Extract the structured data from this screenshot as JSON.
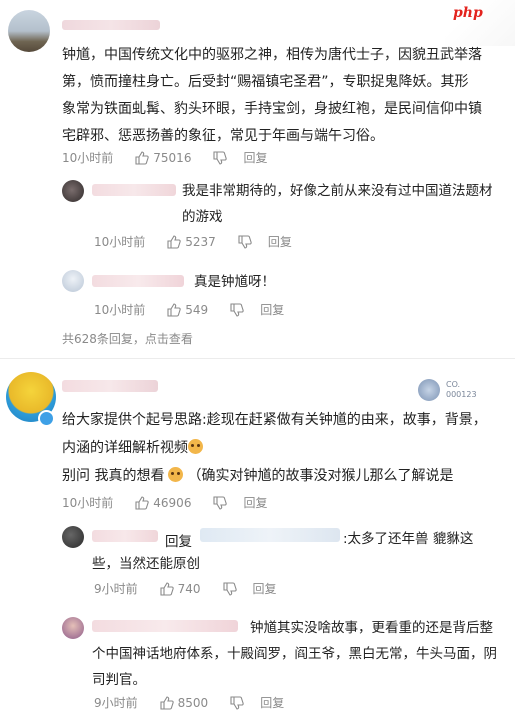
{
  "brand": {
    "watermark": "php"
  },
  "comments": [
    {
      "id": "c1",
      "text": "钟馗，中国传统文化中的驱邪之神，相传为唐代士子，因貌丑武举落第，愤而撞柱身亡。后受封“赐福镇宅圣君”，专职捉鬼降妖。其形象常为铁面虬髯、豹头环眼，手持宝剑，身披红袍，是民间信仰中镇宅辟邪、惩恶扬善的象征，常见于年画与端午习俗。",
      "time": "10小时前",
      "likes": "75016",
      "reply_label": "回复",
      "replies": [
        {
          "text": "我是非常期待的，好像之前从来没有过中国道法题材的游戏",
          "time": "10小时前",
          "likes": "5237",
          "reply_label": "回复"
        },
        {
          "text": "真是钟馗呀！",
          "time": "10小时前",
          "likes": "549",
          "reply_label": "回复"
        }
      ],
      "more_replies": "共628条回复，点击查看"
    },
    {
      "id": "c2",
      "badge": "CO.\n000123",
      "text_line1": "给大家提供个起号思路:趁现在赶紧做有关钟馗的由来，故事，背景，内涵的详细解析视频",
      "text_line2_a": "别问 我真的想看",
      "text_line2_b": "（确实对钟馗的故事没对猴儿那么了解说是",
      "time": "10小时前",
      "likes": "46906",
      "reply_label": "回复",
      "replies": [
        {
          "prefix": "回复",
          "text": ":太多了还年兽 貔貅这些，当然还能原创",
          "time": "9小时前",
          "likes": "740",
          "reply_label": "回复"
        },
        {
          "text": "钟馗其实没啥故事，更看重的还是背后整个中国神话地府体系，十殿阎罗，阎王爷，黑白无常，牛头马面，阴司判官。",
          "time": "9小时前",
          "likes": "8500",
          "reply_label": "回复"
        }
      ]
    }
  ],
  "icons": {
    "like": "thumbs-up-icon",
    "dislike": "thumbs-down-icon",
    "emoji": "cat-emoji-icon"
  },
  "colors": {
    "text": "#222222",
    "meta": "#8a8a8a",
    "link": "#8a8a8a",
    "watermark": "#e3231e"
  }
}
